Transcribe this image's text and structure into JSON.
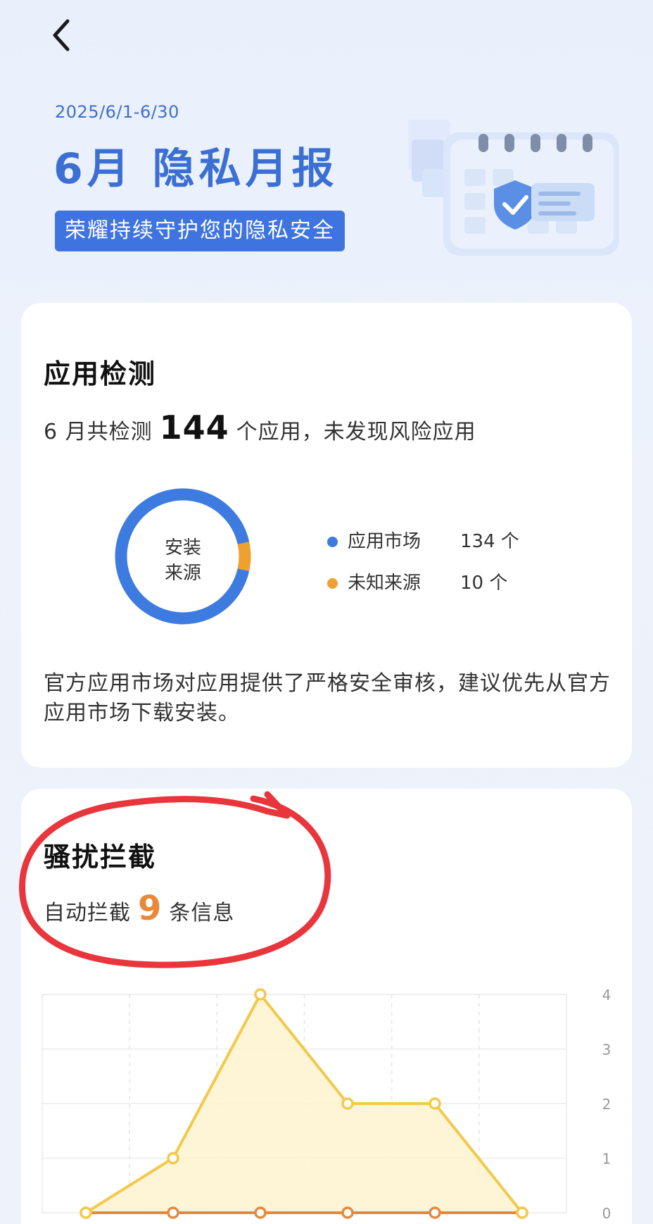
{
  "header": {
    "back_icon": "chevron-left-icon",
    "date_range": "2025/6/1-6/30",
    "title": "6月 隐私月报",
    "subtitle": "荣耀持续守护您的隐私安全"
  },
  "app_check": {
    "title": "应用检测",
    "summary_prefix": "6 月共检测",
    "count": "144",
    "summary_suffix": "个应用，未发现风险应用",
    "donut_label_line1": "安装",
    "donut_label_line2": "来源",
    "sources": [
      {
        "label": "应用市场",
        "value": "134 个",
        "count": 134,
        "color": "#3d7be0"
      },
      {
        "label": "未知来源",
        "value": "10 个",
        "count": 10,
        "color": "#f0a030"
      }
    ],
    "note": "官方应用市场对应用提供了严格安全审核，建议优先从官方应用市场下载安装。"
  },
  "block": {
    "title": "骚扰拦截",
    "summary_prefix": "自动拦截",
    "count": "9",
    "summary_suffix": "条信息"
  },
  "chart_data": {
    "type": "line",
    "x": [
      1,
      2,
      3,
      4,
      5,
      6
    ],
    "ylim": [
      0,
      4
    ],
    "y_ticks": [
      "0",
      "1",
      "2",
      "3",
      "4"
    ],
    "series": [
      {
        "color": "#f2c94c",
        "values": [
          0,
          1,
          4,
          2,
          2,
          0
        ]
      },
      {
        "color": "#e8893a",
        "values": [
          0,
          0,
          0,
          0,
          0,
          0
        ]
      }
    ],
    "grid": true
  },
  "colors": {
    "accent_blue": "#3f74e0",
    "annotation_red": "#e8363c"
  }
}
